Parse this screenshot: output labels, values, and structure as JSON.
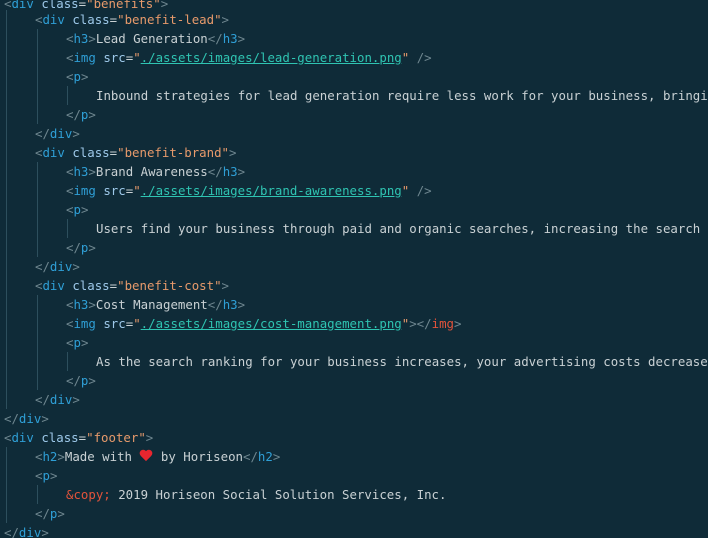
{
  "colors": {
    "background": "#0f2b38",
    "tag": "#2f9fd6",
    "bracket": "#6f8790",
    "attribute": "#9ec9ea",
    "string": "#e79a6b",
    "link": "#2fc4b2",
    "text": "#c9d1d4",
    "entity": "#e2533b",
    "heart": "#e8262f"
  },
  "code": {
    "l0": {
      "attr": "class",
      "value": "\"benefits\""
    },
    "l1": {
      "attr": "class",
      "value": "\"benefit-lead\""
    },
    "l2": {
      "text": "Lead Generation"
    },
    "l3": {
      "attr": "src",
      "quote": "\"",
      "path": "./assets/images/lead-generation.png"
    },
    "l5": {
      "text": "Inbound strategies for lead generation require less work for your business, bringing"
    },
    "l8": {
      "attr": "class",
      "value": "\"benefit-brand\""
    },
    "l9": {
      "text": "Brand Awareness"
    },
    "l10": {
      "attr": "src",
      "quote": "\"",
      "path": "./assets/images/brand-awareness.png"
    },
    "l12": {
      "text": "Users find your business through paid and organic searches, increasing the search"
    },
    "l15": {
      "attr": "class",
      "value": "\"benefit-cost\""
    },
    "l16": {
      "text": "Cost Management"
    },
    "l17": {
      "attr": "src",
      "quote": "\"",
      "path": "./assets/images/cost-management.png"
    },
    "l19": {
      "text": "As the search ranking for your business increases, your advertising costs decrease"
    },
    "l23": {
      "attr": "class",
      "value": "\"footer\""
    },
    "l24": {
      "before": "Made with ",
      "after": " by Horiseon"
    },
    "l26": {
      "entity": "&copy;",
      "text": " 2019 Horiseon Social Solution Services, Inc."
    }
  },
  "tags": {
    "div": "div",
    "h3": "h3",
    "img": "img",
    "p": "p",
    "h2": "h2"
  },
  "icons": {
    "heart": "heart-emoji-icon"
  }
}
